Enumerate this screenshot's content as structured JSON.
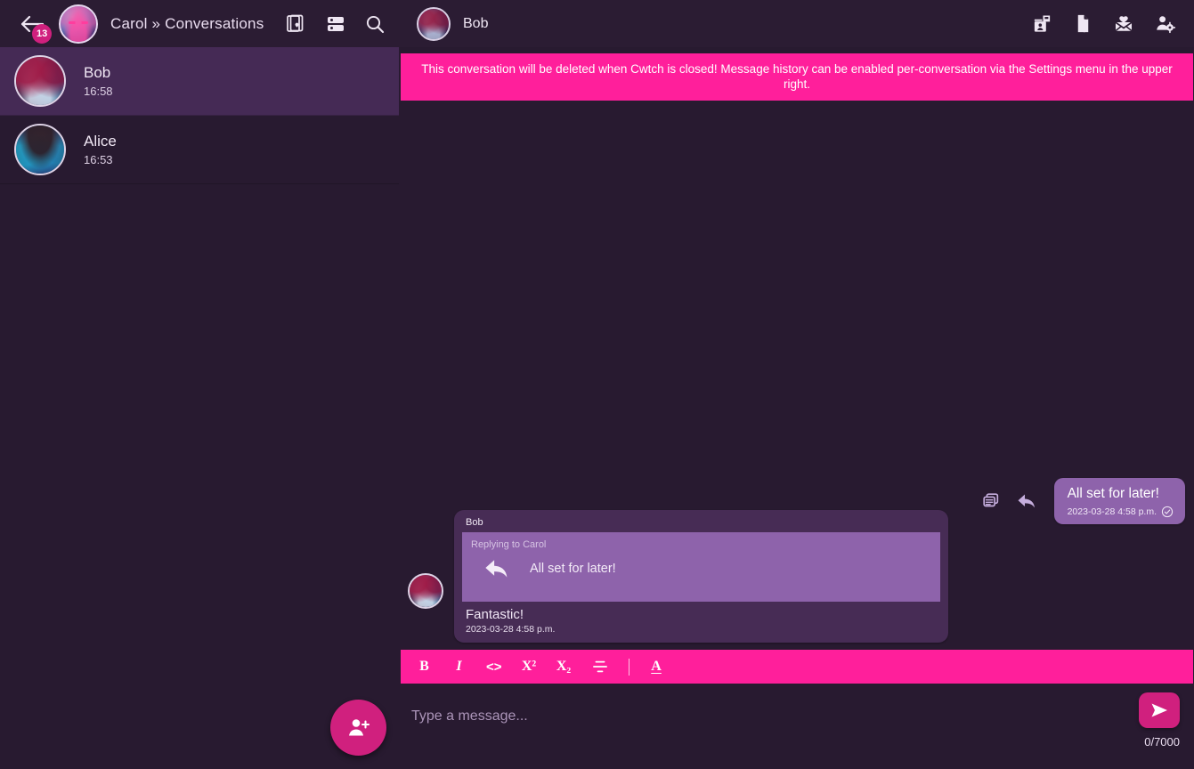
{
  "app": {
    "name": "Cwtch",
    "colors": {
      "background": "#281a30",
      "header": "#2b1c33",
      "accent_pink": "#ff1f9b",
      "accent_pink_dark": "#d0207e",
      "bubble_sent": "#8e63ab",
      "bubble_received": "#472c55",
      "row_selected": "#452a55",
      "text_primary": "#f0e7f4"
    }
  },
  "left_header": {
    "back_button_label": "back",
    "unread_badge": "13",
    "profile_avatar_name": "carol-avatar",
    "title": "Carol » Conversations",
    "icons": [
      {
        "name": "profiles-icon",
        "label": "Profiles"
      },
      {
        "name": "servers-icon",
        "label": "Servers"
      },
      {
        "name": "search-icon",
        "label": "Search"
      }
    ]
  },
  "right_header": {
    "peer_avatar_name": "bob-avatar",
    "peer_name": "Bob",
    "icons": [
      {
        "name": "save-contact-icon",
        "label": "Save Contact"
      },
      {
        "name": "file-attachment-icon",
        "label": "Send File"
      },
      {
        "name": "invite-icon",
        "label": "Send Invite"
      },
      {
        "name": "manage-contact-icon",
        "label": "Manage Contact"
      }
    ]
  },
  "sidebar": {
    "conversations": [
      {
        "name": "Bob",
        "time": "16:58",
        "selected": true,
        "avatar": "bob-avatar"
      },
      {
        "name": "Alice",
        "time": "16:53",
        "selected": false,
        "avatar": "alice-avatar"
      }
    ],
    "fab_label": "Add Contact"
  },
  "chat": {
    "banner": "This conversation will be deleted when Cwtch is closed! Message history can be enabled per-conversation via the Settings menu in the upper right.",
    "sent_message": {
      "text": "All set for later!",
      "timestamp": "2023-03-28 4:58 p.m.",
      "status": "sent-check",
      "actions": [
        {
          "name": "copy-message-icon",
          "label": "Copy"
        },
        {
          "name": "reply-icon",
          "label": "Reply"
        }
      ]
    },
    "received_message": {
      "sender": "Bob",
      "quote_label": "Replying to Carol",
      "quote_text": "All set for later!",
      "text": "Fantastic!",
      "timestamp": "2023-03-28 4:58 p.m."
    }
  },
  "composer": {
    "format_buttons": [
      {
        "name": "bold-button",
        "label": "B"
      },
      {
        "name": "italic-button",
        "label": "I"
      },
      {
        "name": "code-button",
        "label": "<>"
      },
      {
        "name": "superscript-button",
        "label": "X²"
      },
      {
        "name": "subscript-button",
        "label": "X₂"
      },
      {
        "name": "strikethrough-button",
        "label": "S"
      },
      {
        "name": "text-color-button",
        "label": "A"
      }
    ],
    "input_value": "",
    "input_placeholder": "Type a message...",
    "char_count": "0/7000",
    "send_label": "Send"
  }
}
